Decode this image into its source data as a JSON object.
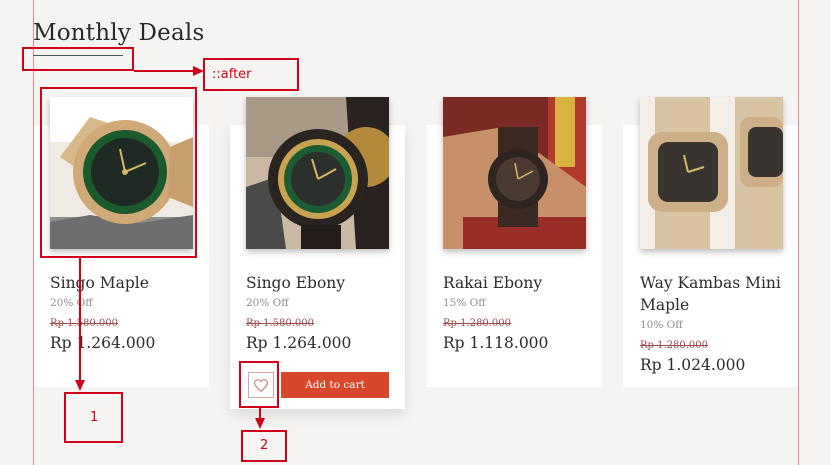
{
  "section": {
    "title": "Monthly Deals"
  },
  "products": [
    {
      "name": "Singo Maple",
      "discount": "20% Off",
      "old_price": "Rp 1.580.000",
      "price": "Rp 1.264.000"
    },
    {
      "name": "Singo Ebony",
      "discount": "20% Off",
      "old_price": "Rp 1.580.000",
      "price": "Rp 1.264.000"
    },
    {
      "name": "Rakai Ebony",
      "discount": "15% Off",
      "old_price": "Rp 1.280.000",
      "price": "Rp 1.118.000"
    },
    {
      "name_line1": "Way Kambas Mini",
      "name_line2": "Maple",
      "discount": "10% Off",
      "old_price": "Rp 1.280.000",
      "price": "Rp 1.024.000"
    }
  ],
  "actions": {
    "add_to_cart": "Add to cart"
  },
  "annotations": {
    "after": "::after",
    "label1": "1",
    "label2": "2"
  },
  "colors": {
    "accent": "#d8472c",
    "annotation": "#d0021b",
    "background": "#f6f4f3"
  },
  "icons": {
    "wishlist": "heart-icon"
  }
}
